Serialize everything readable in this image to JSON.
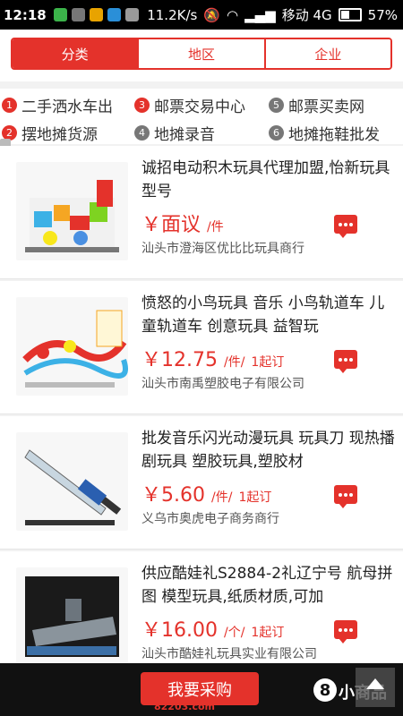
{
  "status_bar": {
    "time": "12:18",
    "network_speed": "11.2K/s",
    "carrier": "移动 4G",
    "battery": "57%",
    "battery_level": 0.57
  },
  "tabs": [
    {
      "label": "分类",
      "active": true
    },
    {
      "label": "地区",
      "active": false
    },
    {
      "label": "企业",
      "active": false
    }
  ],
  "links": [
    {
      "num": "1",
      "label": "二手洒水车出",
      "color": "#e4322b"
    },
    {
      "num": "3",
      "label": "邮票交易中心",
      "color": "#e4322b"
    },
    {
      "num": "5",
      "label": "邮票买卖网",
      "color": "#777777"
    },
    {
      "num": "2",
      "label": "摆地摊货源",
      "color": "#e4322b"
    },
    {
      "num": "4",
      "label": "地摊录音",
      "color": "#777777"
    },
    {
      "num": "6",
      "label": "地摊拖鞋批发",
      "color": "#777777"
    }
  ],
  "products": [
    {
      "title": "诚招电动积木玩具代理加盟,怡新玩具型号",
      "price": "￥面议",
      "unit": "/件",
      "moq": "",
      "company": "汕头市澄海区优比比玩具商行"
    },
    {
      "title": "愤怒的小鸟玩具 音乐 小鸟轨道车 儿童轨道车 创意玩具 益智玩",
      "price": "￥12.75",
      "unit": "/件/",
      "moq": "1起订",
      "company": "汕头市南禹塑胶电子有限公司"
    },
    {
      "title": "批发音乐闪光动漫玩具 玩具刀 现热播剧玩具 塑胶玩具,塑胶材",
      "price": "￥5.60",
      "unit": "/件/",
      "moq": "1起订",
      "company": "义乌市奥虎电子商务商行"
    },
    {
      "title": "供应酷娃礼S2884-2礼辽宁号 航母拼图 模型玩具,纸质材质,可加",
      "price": "￥16.00",
      "unit": "/个/",
      "moq": "1起订",
      "company": "汕头市酷娃礼玩具实业有限公司"
    }
  ],
  "bottom": {
    "buy_label": "我要采购",
    "watermark": "82203.com",
    "logo_mark": "8",
    "logo_text": "小商品"
  }
}
